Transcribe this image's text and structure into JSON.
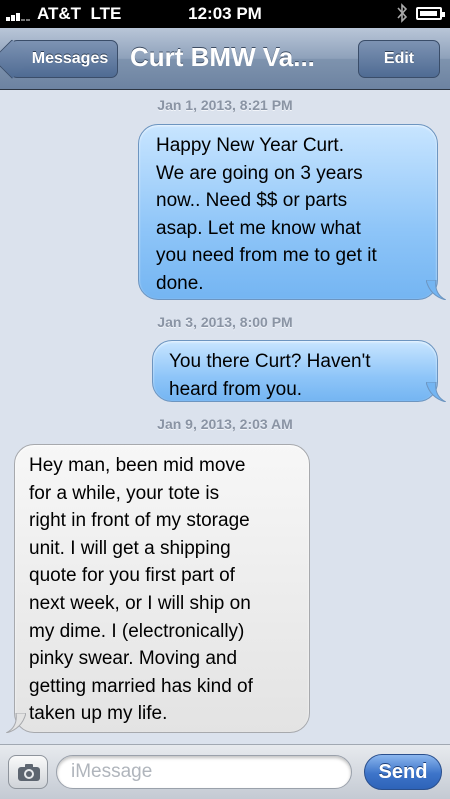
{
  "status_bar": {
    "carrier": "AT&T",
    "network": "LTE",
    "time": "12:03 PM"
  },
  "nav": {
    "back_label": "Messages",
    "title": "Curt BMW Va...",
    "edit_label": "Edit"
  },
  "conversation": {
    "timestamps": [
      "Jan 1, 2013, 8:21 PM",
      "Jan 3, 2013, 8:00 PM",
      "Jan 9, 2013, 2:03 AM"
    ],
    "messages": [
      {
        "direction": "sent",
        "lines": [
          "Happy New Year Curt.",
          "We are going on 3 years",
          "now..  Need $$ or parts",
          "asap.  Let me know what",
          "you need from me to get it",
          "done."
        ]
      },
      {
        "direction": "sent",
        "lines": [
          "You there Curt?  Haven't",
          "heard from you."
        ]
      },
      {
        "direction": "received",
        "lines": [
          "Hey man, been mid move",
          "for a while, your tote is",
          "right in front of my storage",
          "unit. I will get a shipping",
          "quote for you first part of",
          "next week, or I will ship on",
          "my dime. I (electronically)",
          "pinky swear.  Moving and",
          "getting married has kind of",
          "taken up my life."
        ]
      }
    ]
  },
  "composer": {
    "placeholder": "iMessage",
    "send_label": "Send",
    "camera_icon": "camera-icon"
  },
  "colors": {
    "sent_bubble": "#8ec5f8",
    "received_bubble": "#e8e8e8",
    "background": "#dbe2ed",
    "nav_bar": "#7e93ae"
  }
}
